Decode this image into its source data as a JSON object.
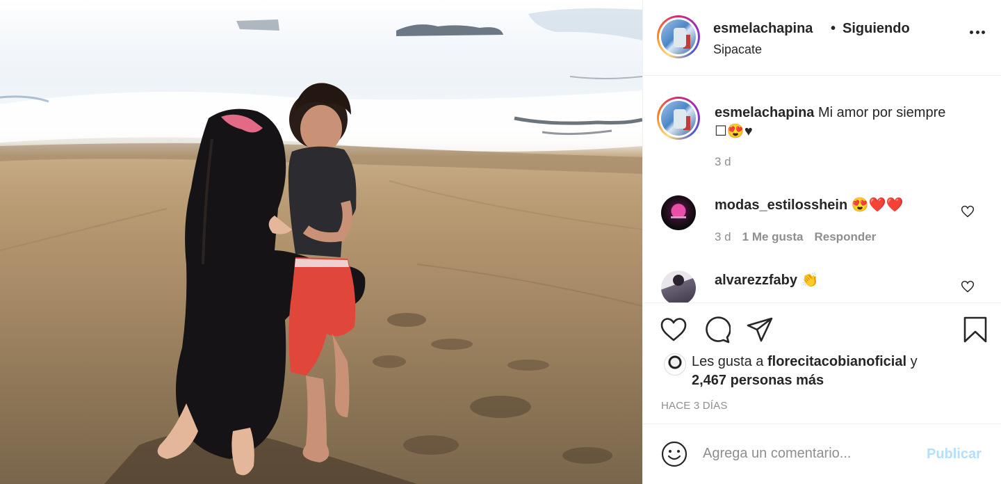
{
  "header": {
    "username": "esmelachapina",
    "separator": "•",
    "follow_status": "Siguiendo",
    "location": "Sipacate"
  },
  "caption": {
    "username": "esmelachapina",
    "text": "Mi amor por siempre",
    "emoji_line": "☐😍♥",
    "time": "3 d"
  },
  "comments": [
    {
      "username": "modas_estilosshein",
      "text": "😍❤️❤️",
      "time": "3 d",
      "likes": "1 Me gusta",
      "reply": "Responder"
    },
    {
      "username": "alvarezzfaby",
      "text": "👏"
    }
  ],
  "likes": {
    "prefix": "Les gusta a",
    "user": "florecitacobianoficial",
    "suffix": "y",
    "others": "2,467 personas más"
  },
  "posted": "HACE 3 DÍAS",
  "add_comment": {
    "placeholder": "Agrega un comentario...",
    "publish_label": "Publicar"
  },
  "icons": {
    "like": "heart-icon",
    "comment": "comment-icon",
    "share": "paper-plane-icon",
    "save": "bookmark-icon",
    "more": "more-options-icon",
    "emoji": "emoji-icon"
  },
  "colors": {
    "text": "#262626",
    "muted": "#8e8e8e",
    "publish_disabled": "#b2dffc",
    "border": "#efefef"
  }
}
